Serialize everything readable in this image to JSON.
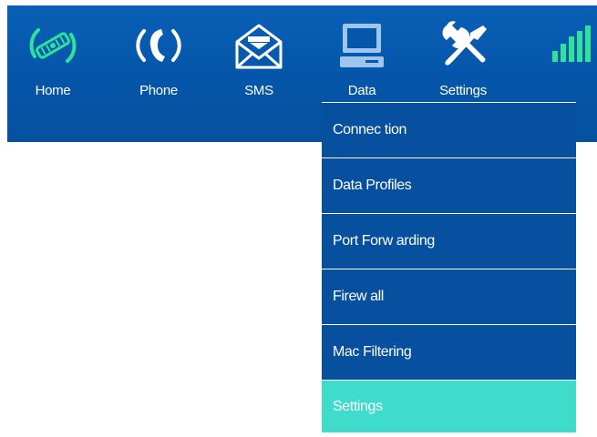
{
  "nav": {
    "items": [
      {
        "label": "Home",
        "icon": "satellite-icon",
        "color": "#2ee29a"
      },
      {
        "label": "Phone",
        "icon": "phone-icon",
        "color": "#ffffff"
      },
      {
        "label": "SMS",
        "icon": "envelope-icon",
        "color": "#ffffff"
      },
      {
        "label": "Data",
        "icon": "computer-icon",
        "color": "#9fc4ee"
      },
      {
        "label": "Settings",
        "icon": "tools-icon",
        "color": "#ffffff"
      }
    ],
    "signal_icon": "signal-strength-icon",
    "signal_color": "#2ee29a",
    "bar_color": "#0557ab"
  },
  "data_menu": {
    "items": [
      {
        "label": "Connec tion"
      },
      {
        "label": "Data Profiles"
      },
      {
        "label": "Port Forw arding"
      },
      {
        "label": "Firew all"
      },
      {
        "label": "Mac Filtering"
      },
      {
        "label": "Settings"
      }
    ],
    "active_index": 5,
    "active_color": "#40dccb",
    "item_color": "#06509f"
  }
}
